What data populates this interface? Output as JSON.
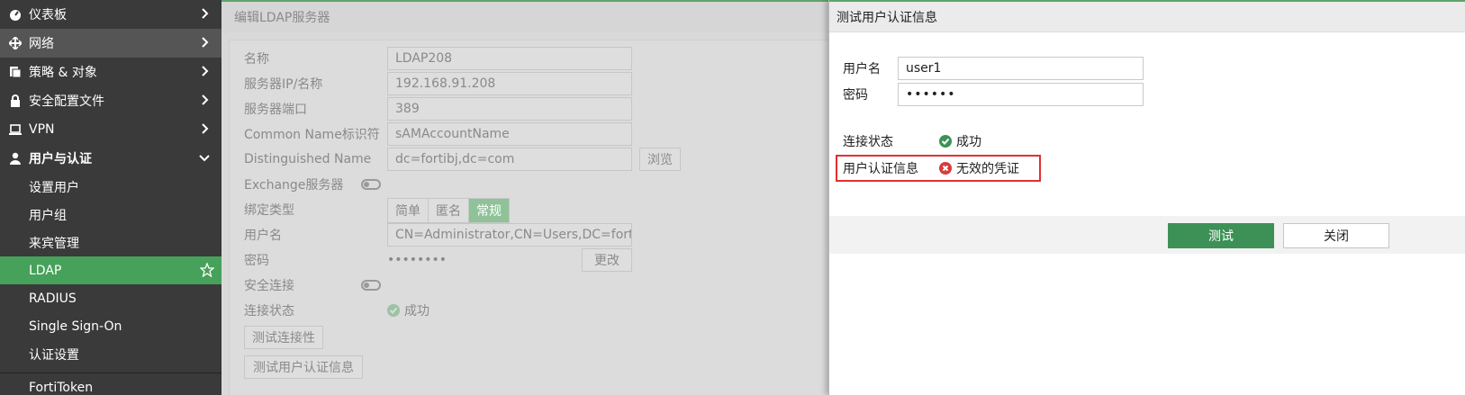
{
  "sidebar": {
    "items": [
      {
        "label": "仪表板",
        "icon": "dashboard-icon"
      },
      {
        "label": "网络",
        "icon": "network-icon"
      },
      {
        "label": "策略 & 对象",
        "icon": "policy-icon"
      },
      {
        "label": "安全配置文件",
        "icon": "lock-icon"
      },
      {
        "label": "VPN",
        "icon": "monitor-icon"
      },
      {
        "label": "用户与认证",
        "icon": "user-icon"
      }
    ],
    "subitems": [
      {
        "label": "设置用户"
      },
      {
        "label": "用户组"
      },
      {
        "label": "来宾管理"
      },
      {
        "label": "LDAP"
      },
      {
        "label": "RADIUS"
      },
      {
        "label": "Single Sign-On"
      },
      {
        "label": "认证设置"
      }
    ],
    "bottom_item": "FortiToken",
    "active_color": "#46a15a"
  },
  "editor": {
    "title": "编辑LDAP服务器",
    "fields": {
      "name_label": "名称",
      "name_value": "LDAP208",
      "ip_label": "服务器IP/名称",
      "ip_value": "192.168.91.208",
      "port_label": "服务器端口",
      "port_value": "389",
      "cn_label": "Common Name标识符",
      "cn_value": "sAMAccountName",
      "dn_label": "Distinguished Name",
      "dn_value": "dc=fortibj,dc=com",
      "browse_label": "浏览",
      "exchange_label": "Exchange服务器",
      "bind_label": "绑定类型",
      "bind_options": [
        "简单",
        "匿名",
        "常规"
      ],
      "bind_selected": "常规",
      "username_label": "用户名",
      "username_value": "CN=Administrator,CN=Users,DC=fortil",
      "password_label": "密码",
      "password_value": "••••••••",
      "change_label": "更改",
      "secure_label": "安全连接",
      "conn_status_label": "连接状态",
      "conn_status_value": "成功",
      "test_conn_button": "测试连接性",
      "test_user_button": "测试用户认证信息"
    }
  },
  "panel": {
    "title": "测试用户认证信息",
    "username_label": "用户名",
    "username_value": "user1",
    "password_label": "密码",
    "password_value": "••••••",
    "conn_status_label": "连接状态",
    "conn_status_value": "成功",
    "auth_label": "用户认证信息",
    "auth_value": "无效的凭证",
    "test_button": "测试",
    "close_button": "关闭",
    "success_color": "#3d9156",
    "error_color": "#d93a3a"
  }
}
